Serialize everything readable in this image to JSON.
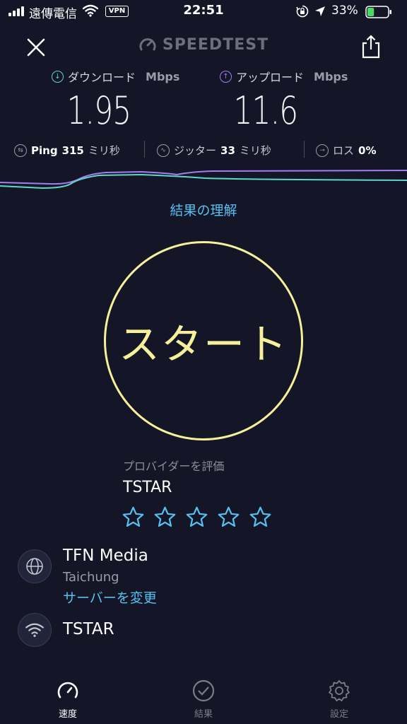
{
  "status_bar": {
    "carrier": "遠傳電信",
    "vpn": "VPN",
    "time": "22:51",
    "battery_percent": "33%",
    "battery_level": 0.33
  },
  "header": {
    "logo": "SPEEDTEST",
    "close_icon": "close-icon",
    "share_icon": "share-icon"
  },
  "metrics": {
    "download": {
      "label": "ダウンロード",
      "unit": "Mbps",
      "value": "1.95"
    },
    "upload": {
      "label": "アップロード",
      "unit": "Mbps",
      "value": "11.6"
    },
    "ping": {
      "label": "Ping",
      "value": "315",
      "unit": "ミリ秒"
    },
    "jitter": {
      "label": "ジッター",
      "value": "33",
      "unit": "ミリ秒"
    },
    "loss": {
      "label": "ロス",
      "value": "0%"
    }
  },
  "links": {
    "understand_results": "結果の理解"
  },
  "start_button": {
    "label": "スタート"
  },
  "provider": {
    "rate_label": "プロバイダーを評価",
    "name": "TSTAR",
    "stars_total": 5,
    "stars_filled": 0
  },
  "server": {
    "name": "TFN Media",
    "city": "Taichung",
    "change_label": "サーバーを変更"
  },
  "connection": {
    "isp": "TSTAR"
  },
  "tabs": [
    {
      "label": "速度",
      "icon": "speedometer-icon",
      "active": true
    },
    {
      "label": "結果",
      "icon": "check-circle-icon",
      "active": false
    },
    {
      "label": "設定",
      "icon": "gear-icon",
      "active": false
    }
  ],
  "colors": {
    "background": "#141526",
    "download": "#5ed6c9",
    "upload": "#a47cf0",
    "start": "#f7f09a",
    "link": "#56c1f0"
  }
}
